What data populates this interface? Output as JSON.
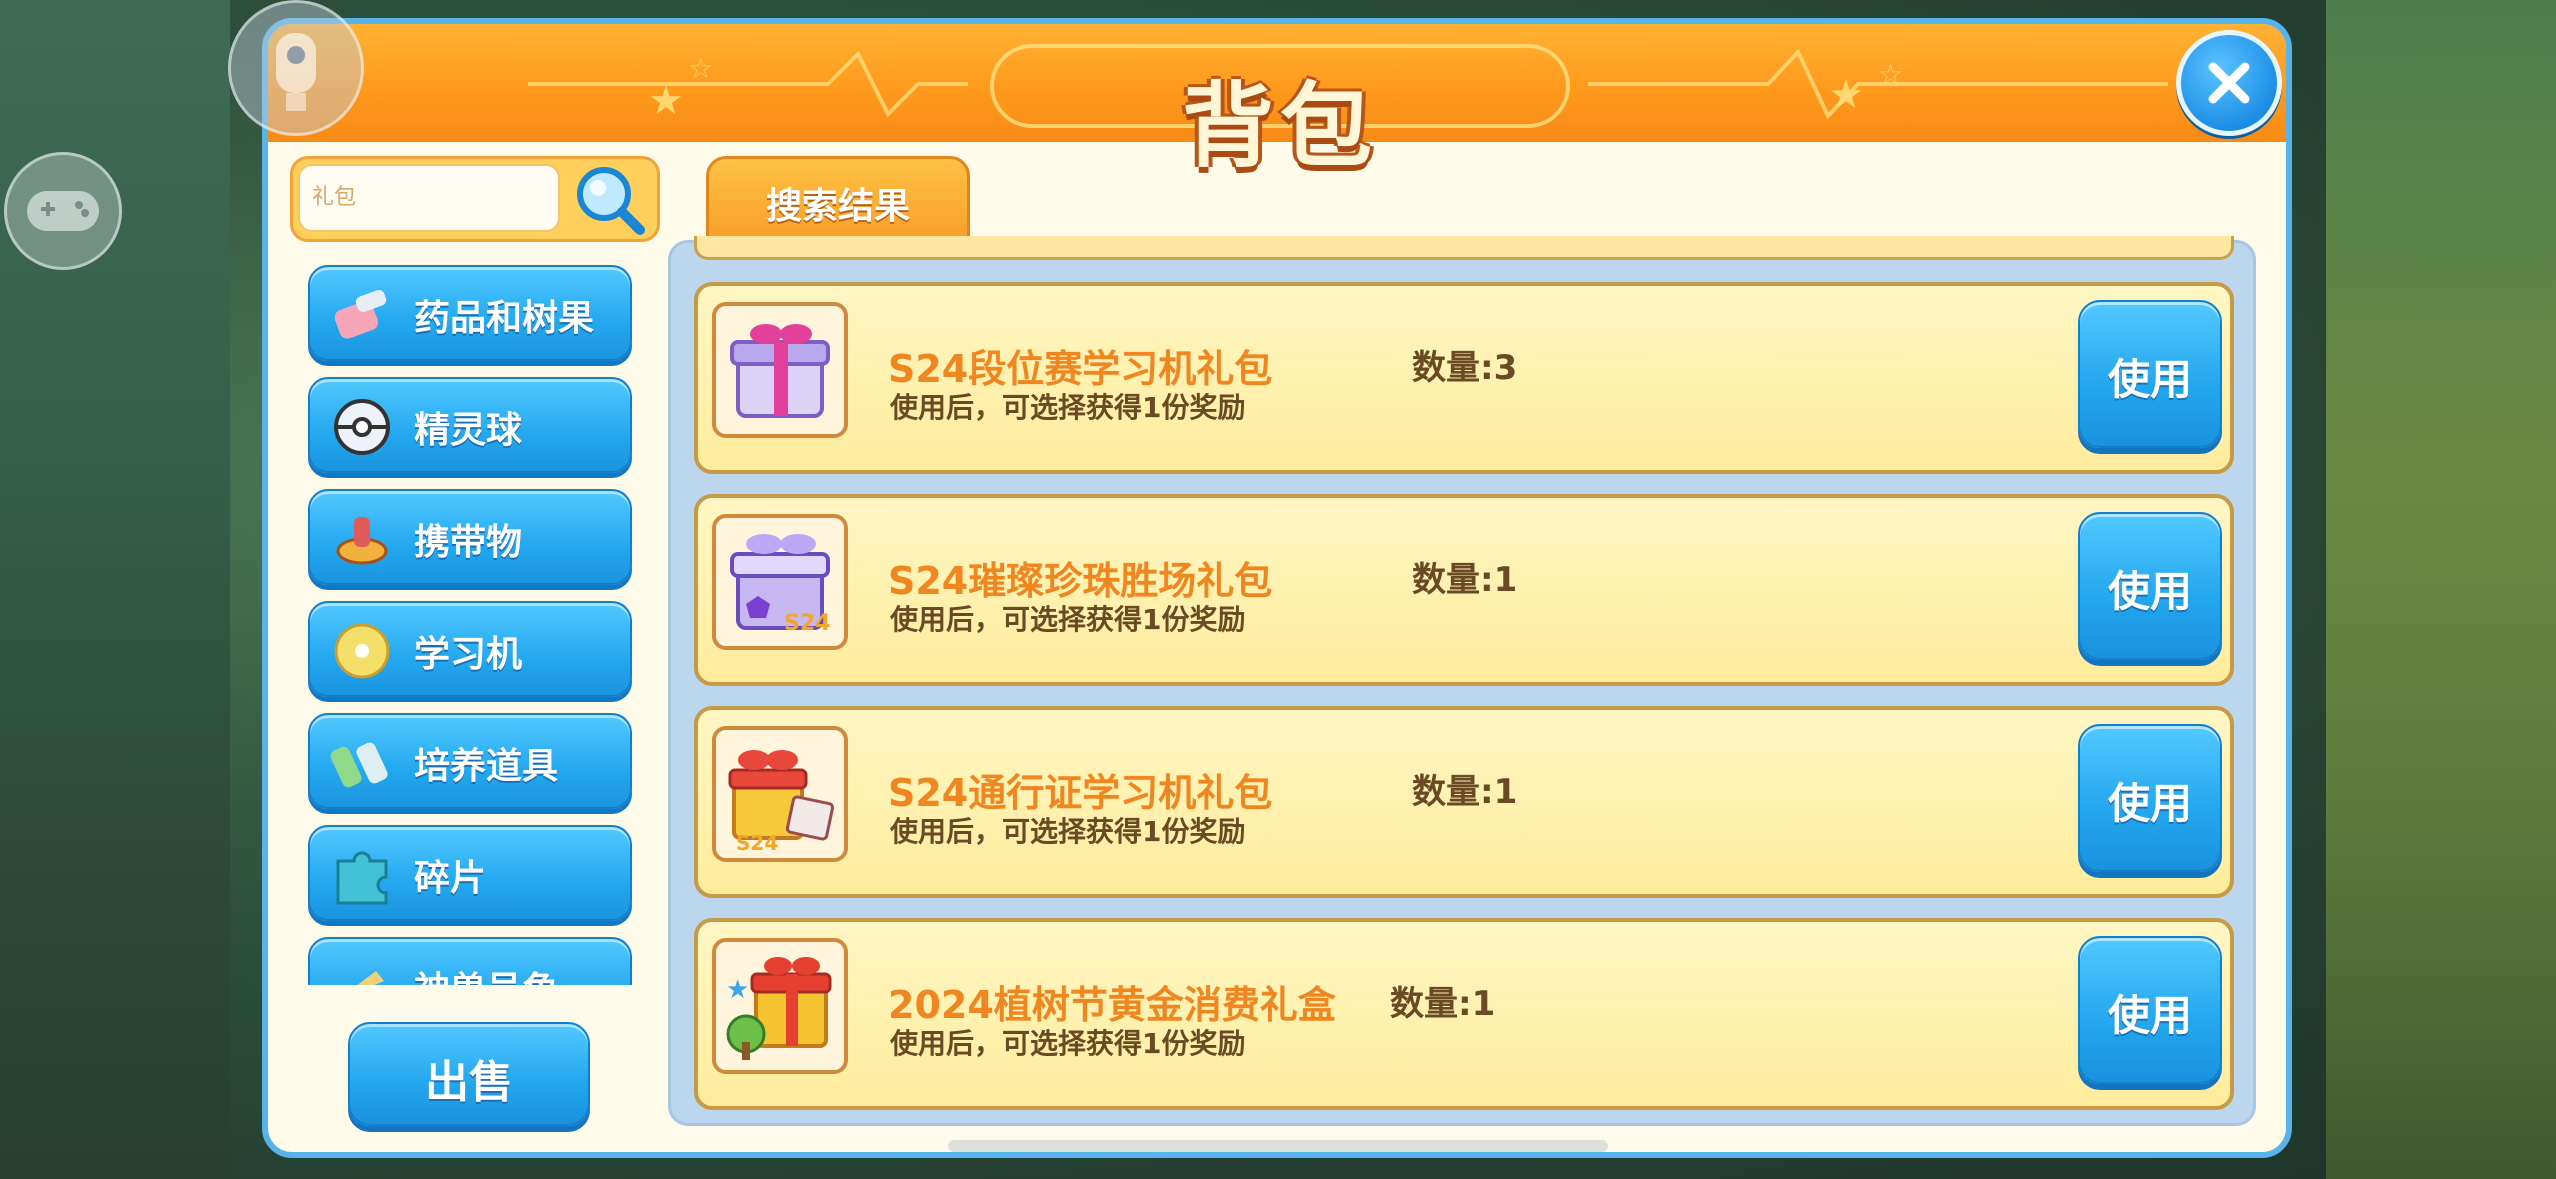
{
  "window": {
    "title": "背包"
  },
  "search": {
    "value": "礼包",
    "placeholder": ""
  },
  "tab": {
    "label": "搜索结果"
  },
  "sidebar": {
    "items": [
      {
        "label": "药品和树果",
        "icon": "potion-icon"
      },
      {
        "label": "精灵球",
        "icon": "pokeball-icon"
      },
      {
        "label": "携带物",
        "icon": "held-item-icon"
      },
      {
        "label": "学习机",
        "icon": "disc-icon"
      },
      {
        "label": "培养道具",
        "icon": "training-item-icon"
      },
      {
        "label": "碎片",
        "icon": "puzzle-icon"
      },
      {
        "label": "神兽号角",
        "icon": "horn-icon"
      }
    ]
  },
  "sell_button": {
    "label": "出售"
  },
  "items": [
    {
      "name": "S24段位赛学习机礼包",
      "desc": "使用后，可选择获得1份奖励",
      "qty": "数量:3",
      "use": "使用",
      "icon": "gift-box-purple-icon"
    },
    {
      "name": "S24璀璨珍珠胜场礼包",
      "desc": "使用后，可选择获得1份奖励",
      "qty": "数量:1",
      "use": "使用",
      "icon": "gift-box-pearl-icon"
    },
    {
      "name": "S24通行证学习机礼包",
      "desc": "使用后，可选择获得1份奖励",
      "qty": "数量:1",
      "use": "使用",
      "icon": "gift-box-red-icon"
    },
    {
      "name": "2024植树节黄金消费礼盒",
      "desc": "使用后，可选择获得1份奖励",
      "qty": "数量:1",
      "use": "使用",
      "icon": "gift-box-gold-icon"
    }
  ],
  "colors": {
    "accent": "#23a8ef",
    "title_bar": "#ff9a1d",
    "item_name": "#f0861f",
    "panel_border": "#57b4ea"
  }
}
